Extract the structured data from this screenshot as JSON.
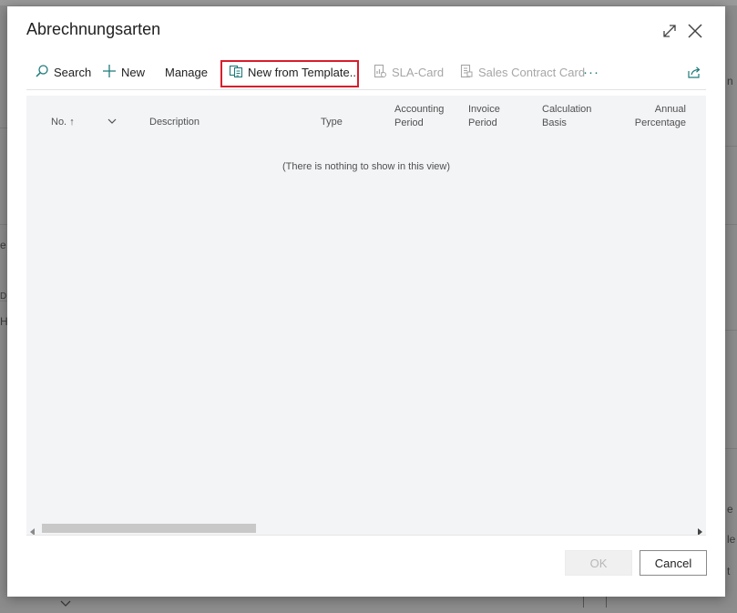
{
  "dialog": {
    "title": "Abrechnungsarten",
    "expand_icon": "expand-icon",
    "close_icon": "close-icon"
  },
  "toolbar": {
    "search": "Search",
    "new": "New",
    "manage": "Manage",
    "new_from_template": "New from Template...",
    "sla_card": "SLA-Card",
    "sales_contract_card": "Sales Contract Card",
    "more": "···"
  },
  "columns": {
    "no": "No.",
    "sort_indicator": "↑",
    "description": "Description",
    "type": "Type",
    "accounting_period_1": "Accounting",
    "accounting_period_2": "Period",
    "invoice_period_1": "Invoice",
    "invoice_period_2": "Period",
    "calculation_basis_1": "Calculation",
    "calculation_basis_2": "Basis",
    "annual_percentage_1": "Annual",
    "annual_percentage_2": "Percentage"
  },
  "grid": {
    "empty_message": "(There is nothing to show in this view)"
  },
  "footer": {
    "ok": "OK",
    "cancel": "Cancel"
  },
  "background": {
    "fragment_a": "e",
    "fragment_b": "D",
    "fragment_c": "H",
    "fragment_d": "n",
    "fragment_e": "e",
    "fragment_f": "le",
    "fragment_g": "t"
  },
  "colors": {
    "highlight": "#d81e2c",
    "accent": "#1f7a7a"
  }
}
